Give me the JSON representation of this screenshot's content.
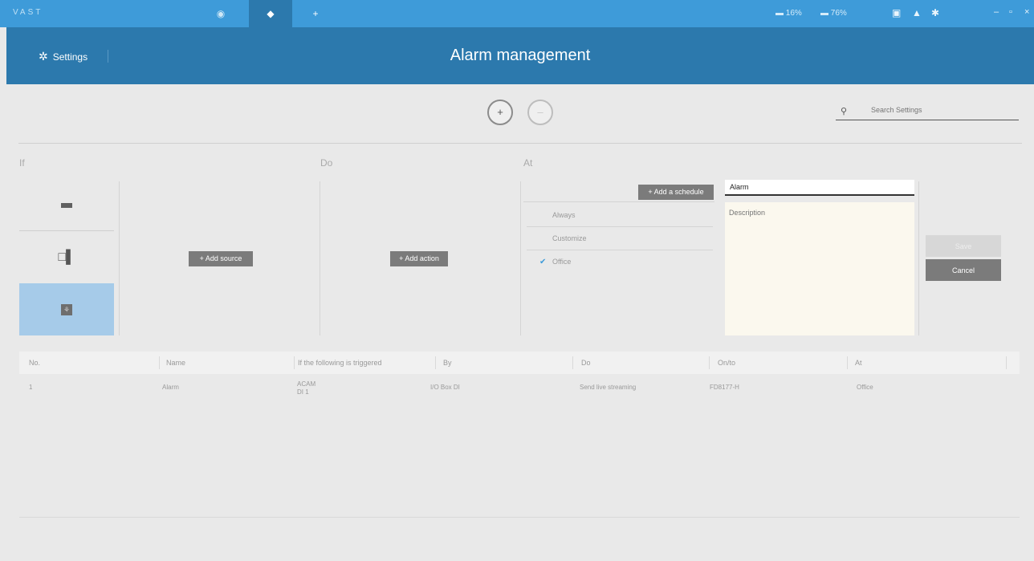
{
  "titlebar": {
    "logo": "VAST",
    "tabs": {
      "liveview": "◉",
      "settings": "◆",
      "add": "+"
    },
    "cpu": "16%",
    "ram": "76%",
    "icons": {
      "a": "▣",
      "b": "▲",
      "c": "✱"
    },
    "window": {
      "minimize": "–",
      "restore": "▫",
      "close": "×"
    }
  },
  "header": {
    "settings_icon": "✲",
    "settings_label": "Settings",
    "title": "Alarm management"
  },
  "toolbar": {
    "add_icon": "+",
    "delete_icon": "–",
    "search_icon": "⚲",
    "search_placeholder": "Search Settings"
  },
  "sections": {
    "if": "If",
    "do": "Do",
    "at": "At"
  },
  "sources": {
    "camera_icon": "camera-icon",
    "device_icon": "□▌",
    "io_icon": "⚘"
  },
  "buttons": {
    "add_source": "+  Add source",
    "add_action": "+  Add action",
    "add_schedule": "+  Add a schedule",
    "save": "Save",
    "cancel": "Cancel"
  },
  "schedules": [
    "Always",
    "Customize",
    "Office"
  ],
  "alarm": {
    "name_value": "Alarm",
    "description_placeholder": "Description"
  },
  "table": {
    "headers": [
      "No.",
      "Name",
      "If the following is triggered",
      "By",
      "Do",
      "On/to",
      "At"
    ],
    "rows": [
      {
        "no": "1",
        "name": "Alarm",
        "trigger_line1": "ACAM",
        "trigger_line2": "DI 1",
        "by": "I/O Box DI",
        "do": "Send live streaming",
        "on_to": "FD8177-H",
        "at": "Office"
      }
    ]
  }
}
